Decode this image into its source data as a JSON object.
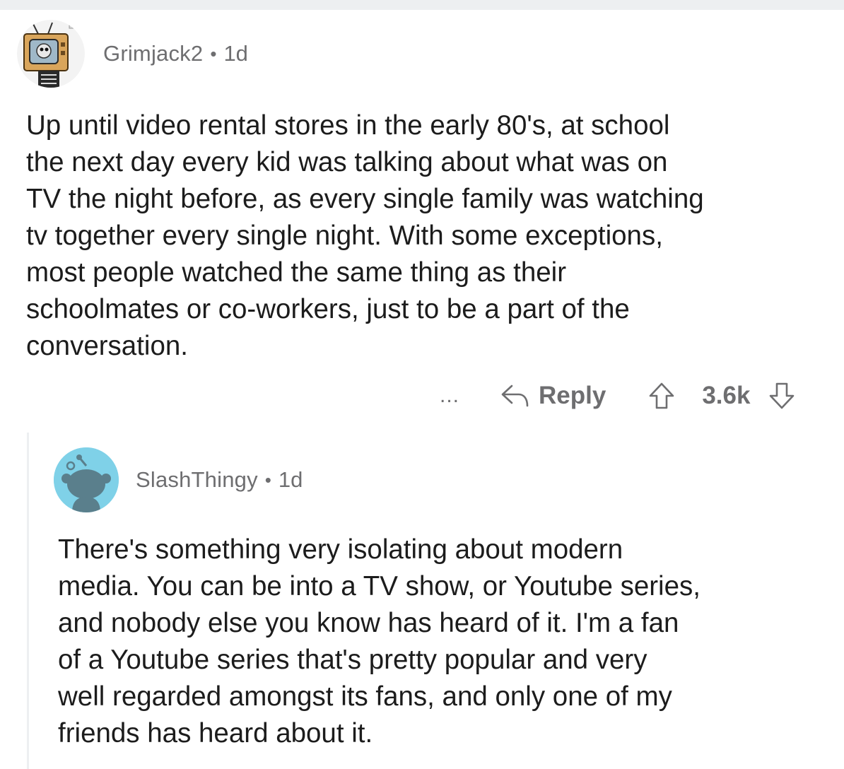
{
  "comments": [
    {
      "username": "Grimjack2",
      "separator": "•",
      "timestamp": "1d",
      "body": "Up until video rental stores in the early 80's, at school\nthe next day every kid was talking about what was on\nTV the night before, as every single family was watching\ntv together every single night. With some exceptions,\nmost people watched the same thing as their\nschoolmates or co-workers, just to be a part of the\nconversation.",
      "actions": {
        "more_label": "...",
        "reply_label": "Reply",
        "vote_count": "3.6k"
      }
    },
    {
      "username": "SlashThingy",
      "separator": "•",
      "timestamp": "1d",
      "body": "There's something very isolating about modern\nmedia. You can be into a TV show, or Youtube series,\nand nobody else you know has heard of it. I'm a fan\nof a Youtube series that's pretty popular and very\nwell regarded amongst its fans, and only one of my\nfriends has heard about it."
    }
  ],
  "icons": {
    "avatar_1": "tv-head-skeleton-avatar",
    "avatar_2": "reddit-snoo-avatar",
    "reply": "reply-arrow-icon",
    "upvote": "upvote-arrow-icon",
    "downvote": "downvote-arrow-icon"
  },
  "colors": {
    "text": "#1c1c1c",
    "meta": "#6e6e70",
    "avatar_2_bg": "#7fd1e8",
    "thread_line": "#edeff1"
  }
}
